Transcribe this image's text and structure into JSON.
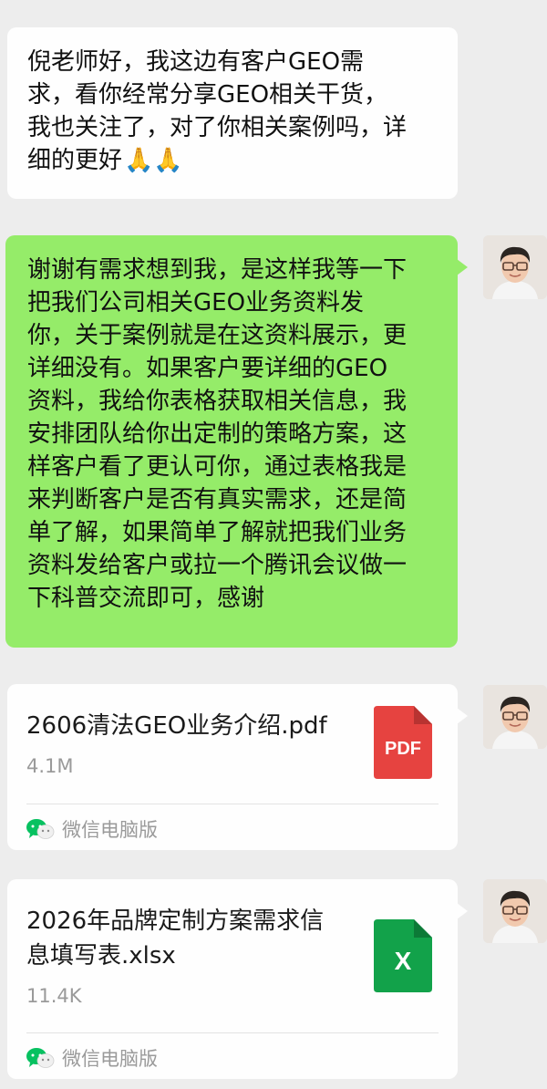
{
  "messages": {
    "incoming": {
      "lines": [
        "倪老师好，我这边有客户GEO需",
        "求，看你经常分享GEO相关干货，",
        "我也关注了，对了你相关案例吗，详",
        "细的更好"
      ],
      "emoji": "🙏🙏"
    },
    "outgoing": {
      "lines": [
        "谢谢有需求想到我，是这样我等一下",
        "把我们公司相关GEO业务资料发",
        "你，关于案例就是在这资料展示，更",
        "详细没有。如果客户要详细的GEO",
        "资料，我给你表格获取相关信息，我",
        "安排团队给你出定制的策略方案，这",
        "样客户看了更认可你，通过表格我是",
        "来判断客户是否有真实需求，还是简",
        "单了解，如果简单了解就把我们业务",
        "资料发给客户或拉一个腾讯会议做一",
        "下科普交流即可，感谢"
      ]
    }
  },
  "files": [
    {
      "name_lines": [
        "2606清法GEO业务介绍.pdf"
      ],
      "size": "4.1M",
      "icon_label": "PDF",
      "icon_name": "pdf-file-icon",
      "icon_color": "#e64340",
      "source": "微信电脑版"
    },
    {
      "name_lines": [
        "2026年品牌定制方案需求信",
        "息填写表.xlsx"
      ],
      "size": "11.4K",
      "icon_label": "X",
      "icon_name": "excel-file-icon",
      "icon_color": "#12a24a",
      "source": "微信电脑版"
    }
  ],
  "colors": {
    "outgoing_bubble": "#95ec69",
    "incoming_bubble": "#fefefe",
    "background": "#ededed",
    "wechat_green": "#07c160"
  }
}
